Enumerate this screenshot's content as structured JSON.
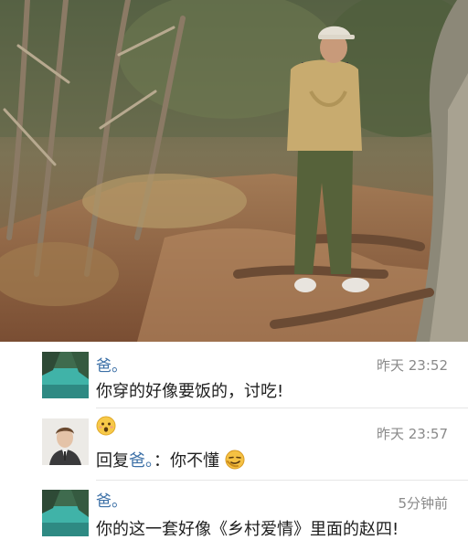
{
  "comments": [
    {
      "author": "爸。",
      "time": "昨天 23:52",
      "text": "你穿的好像要饭的，讨吃!",
      "avatar_icon": "lake-landscape-avatar-icon"
    },
    {
      "author_emoji": "surprised-face-emoji-icon",
      "time": "昨天 23:57",
      "reply_prefix": "回复",
      "reply_to": "爸。",
      "reply_text": "：你不懂",
      "reply_emoji": "smirk-face-emoji-icon",
      "avatar_icon": "man-in-suit-avatar-icon"
    },
    {
      "author": "爸。",
      "time": "5分钟前",
      "text": "你的这一套好像《乡村爱情》里面的赵四!",
      "avatar_icon": "lake-landscape-avatar-icon"
    }
  ],
  "colors": {
    "link_blue": "#3b6fa6",
    "time_gray": "#8a8a8a",
    "text_dark": "#1e1e1e"
  }
}
